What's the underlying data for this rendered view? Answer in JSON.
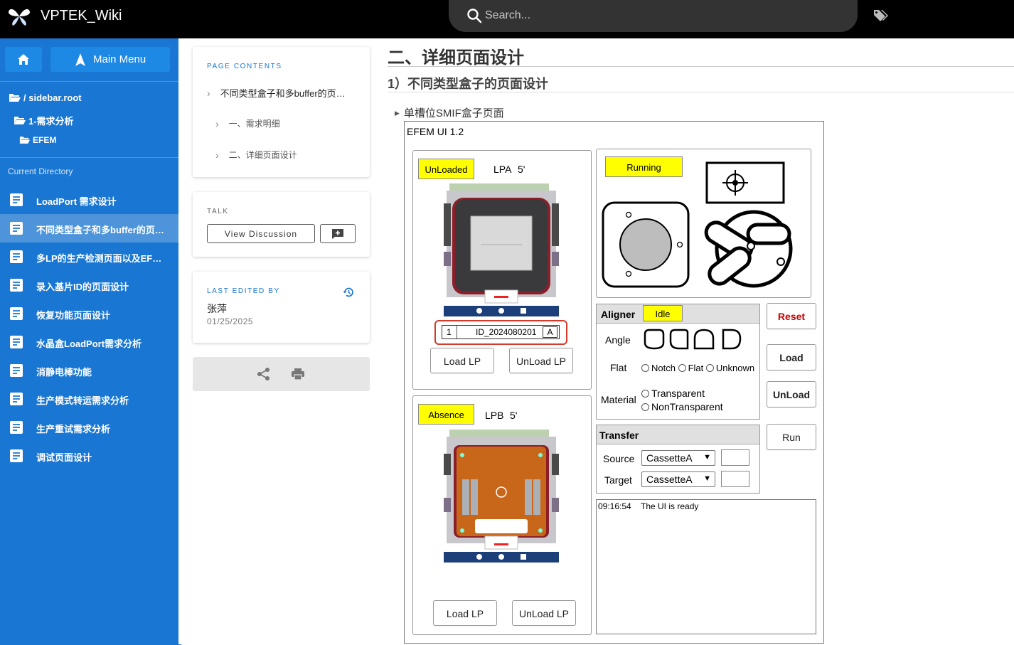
{
  "app": {
    "title": "VPTEK_Wiki"
  },
  "search": {
    "placeholder": "Search..."
  },
  "sidebar": {
    "main_menu": "Main Menu",
    "tree": [
      "/ sidebar.root",
      "1-需求分析",
      "EFEM"
    ],
    "current_dir_label": "Current Directory",
    "items": [
      "LoadPort 需求设计",
      "不同类型盒子和多buffer的页面设计",
      "多LP的生产检测页面以及EFEM页面设计",
      "录入基片ID的页面设计",
      "恢复功能页面设计",
      "水晶盒LoadPort需求分析",
      "消静电棒功能",
      "生产模式转运需求分析",
      "生产重试需求分析",
      "调试页面设计"
    ],
    "active_index": 1
  },
  "toc": {
    "heading": "PAGE CONTENTS",
    "entries": [
      "不同类型盒子和多buffer的页面设计",
      "一、需求明细",
      "二、详细页面设计"
    ]
  },
  "talk": {
    "heading": "TALK",
    "view_discussion": "View Discussion"
  },
  "last_edited": {
    "heading": "LAST EDITED BY",
    "name": "张萍",
    "date": "01/25/2025"
  },
  "content": {
    "h1": "二、详细页面设计",
    "h2": "1）不同类型盒子的页面设计",
    "details_summary": "单槽位SMIF盒子页面"
  },
  "efem": {
    "title": "EFEM UI  1.2",
    "lpa": {
      "status": "UnLoaded",
      "name": "LPA",
      "size": "5'",
      "slot": "1",
      "wafer_id": "ID_2024080201",
      "flag": "A",
      "load": "Load LP",
      "unload": "UnLoad LP"
    },
    "lpb": {
      "status": "Absence",
      "name": "LPB",
      "size": "5'",
      "load": "Load LP",
      "unload": "UnLoad LP"
    },
    "robot_status": "Running",
    "aligner": {
      "title": "Aligner",
      "status": "Idle",
      "angle_label": "Angle",
      "flat_label": "Flat",
      "material_label": "Material",
      "flat_options": [
        "Notch",
        "Flat",
        "Unknown"
      ],
      "material_options": [
        "Transparent",
        "NonTransparent"
      ]
    },
    "buttons": {
      "reset": "Reset",
      "load": "Load",
      "unload": "UnLoad",
      "run": "Run"
    },
    "transfer": {
      "title": "Transfer",
      "source_label": "Source",
      "source_value": "CassetteA",
      "target_label": "Target",
      "target_value": "CassetteA"
    },
    "log": {
      "time": "09:16:54",
      "message": "The UI is ready"
    }
  },
  "colors": {
    "sidebar": "#1976d2",
    "badge": "#ffff00",
    "reset_text": "#cc0000",
    "lpb_plate": "#c8661a"
  }
}
